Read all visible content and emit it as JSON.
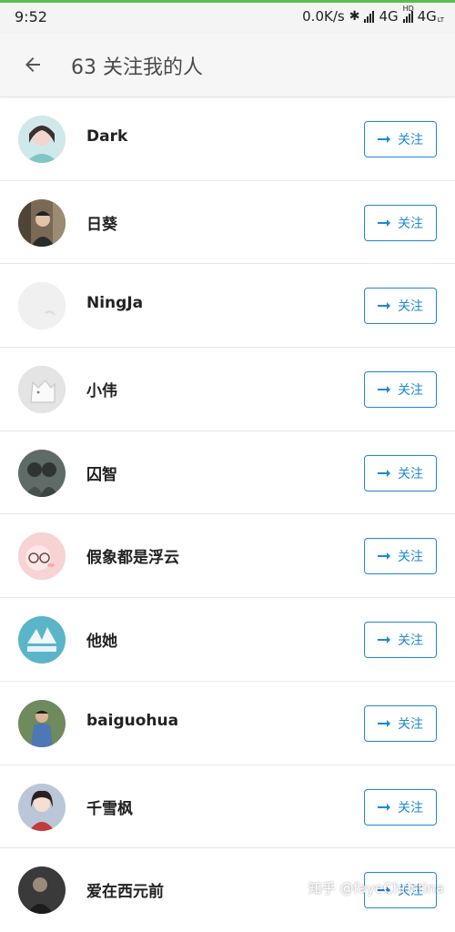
{
  "status_bar": {
    "time": "9:52",
    "speed": "0.0K/s",
    "network1": "4G",
    "network2": "4G",
    "hd": "HD",
    "lte": "LT"
  },
  "header": {
    "title": "63 关注我的人",
    "back_icon": "arrow-left-icon"
  },
  "follow_label": "关注",
  "colors": {
    "accent": "#1e88d8",
    "status_top": "#55c14f"
  },
  "users": [
    {
      "name": "Dark"
    },
    {
      "name": "日葵"
    },
    {
      "name": "NingJa"
    },
    {
      "name": "小伟"
    },
    {
      "name": "囚智"
    },
    {
      "name": "假象都是浮云"
    },
    {
      "name": "他她"
    },
    {
      "name": "baiguohua"
    },
    {
      "name": "千雪枫"
    },
    {
      "name": "爱在西元前"
    }
  ],
  "watermark": "知乎 @fayeChristina"
}
